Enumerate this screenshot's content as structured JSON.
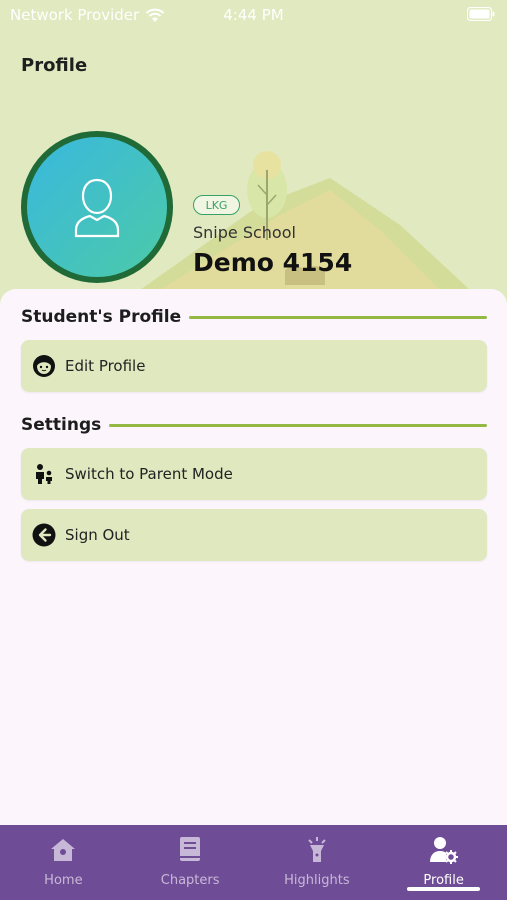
{
  "status_bar": {
    "carrier": "Network Provider",
    "time": "4:44 PM"
  },
  "header": {
    "title": "Profile"
  },
  "student": {
    "grade": "LKG",
    "school": "Snipe School",
    "name": "Demo 4154"
  },
  "sections": {
    "profile": {
      "title": "Student's Profile",
      "items": [
        {
          "label": "Edit Profile",
          "icon": "face-icon"
        }
      ]
    },
    "settings": {
      "title": "Settings",
      "items": [
        {
          "label": "Switch to Parent Mode",
          "icon": "family-icon"
        },
        {
          "label": "Sign Out",
          "icon": "sign-out-icon"
        }
      ]
    }
  },
  "bottom_nav": {
    "items": [
      {
        "label": "Home",
        "icon": "home-icon"
      },
      {
        "label": "Chapters",
        "icon": "book-icon"
      },
      {
        "label": "Highlights",
        "icon": "flashlight-icon"
      },
      {
        "label": "Profile",
        "icon": "user-settings-icon",
        "active": true
      }
    ]
  },
  "colors": {
    "header_bg": "#e0e9bf",
    "panel_bg": "#fcf6fc",
    "item_bg": "#e0e8c0",
    "accent_line": "#93b843",
    "nav_bg": "#6f4c96",
    "avatar_ring": "#1f6a37"
  }
}
